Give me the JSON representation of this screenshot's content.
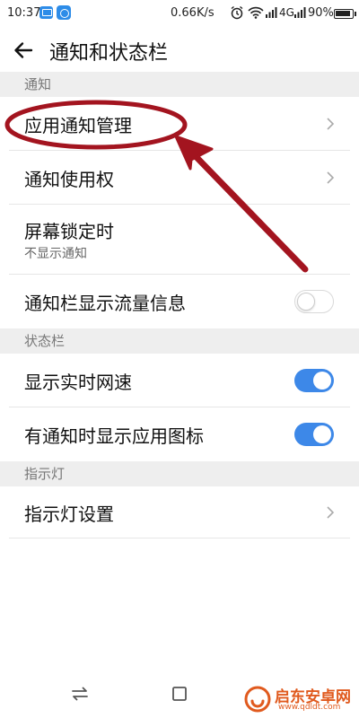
{
  "status_bar": {
    "time": "10:37",
    "net_speed": "0.66K/s",
    "network_type": "4G",
    "battery_percent": "90%",
    "icons": [
      "message-app-icon",
      "browser-app-icon",
      "alarm-icon",
      "wifi-icon",
      "signal-icon",
      "battery-icon"
    ]
  },
  "header": {
    "back_icon": "arrow-left-icon",
    "title": "通知和状态栏"
  },
  "sections": [
    {
      "header": "通知",
      "items": [
        {
          "label": "应用通知管理",
          "control": "chevron"
        },
        {
          "label": "通知使用权",
          "control": "chevron"
        },
        {
          "label": "屏幕锁定时",
          "sublabel": "不显示通知",
          "control": "none"
        },
        {
          "label": "通知栏显示流量信息",
          "control": "toggle",
          "on": false
        }
      ]
    },
    {
      "header": "状态栏",
      "items": [
        {
          "label": "显示实时网速",
          "control": "toggle",
          "on": true
        },
        {
          "label": "有通知时显示应用图标",
          "control": "toggle",
          "on": true
        }
      ]
    },
    {
      "header": "指示灯",
      "items": [
        {
          "label": "指示灯设置",
          "control": "chevron"
        }
      ]
    }
  ],
  "colors": {
    "toggle_on": "#3d88e8",
    "section_bg": "#eeeeee",
    "annotation_red": "#a3141f",
    "watermark": "#e05a1e"
  },
  "navbar": {
    "icons": [
      "switch-apps-icon",
      "home-square-icon"
    ]
  },
  "watermark": {
    "text": "启东安卓网",
    "url": "www.qdldt.com"
  }
}
